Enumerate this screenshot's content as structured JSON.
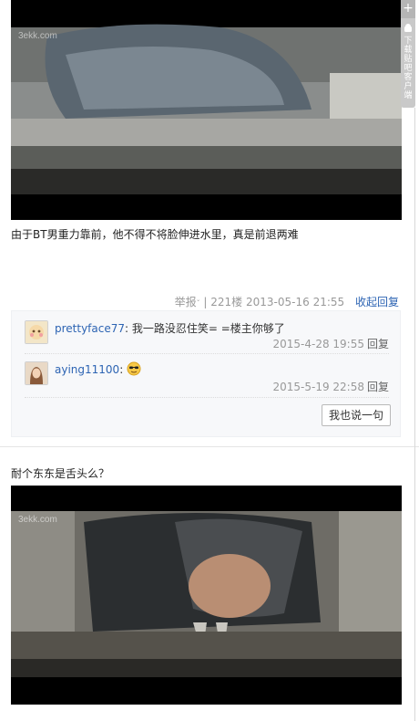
{
  "post1": {
    "watermark": "3ekk.com",
    "caption": "由于BT男重力靠前，他不得不将脸伸进水里，真是前退两难",
    "meta": {
      "report": "举报",
      "floor": "221楼",
      "date": "2013-05-16 21:55",
      "collapse": "收起回复"
    },
    "replies": [
      {
        "user": "prettyface77",
        "text": "我一路没忍住笑= =楼主你够了",
        "time": "2015-4-28 19:55",
        "reply": "回复"
      },
      {
        "user": "aying11100",
        "text": "",
        "time": "2015-5-19 22:58",
        "reply": "回复"
      }
    ],
    "say_button": "我也说一句"
  },
  "post2": {
    "caption": "耐个东东是舌头么？",
    "watermark": "3ekk.com"
  },
  "side": {
    "plus": "+",
    "text": "下载贴吧客户端"
  },
  "colors": {
    "link": "#2d64b3",
    "meta": "#999999",
    "reply_bg": "#f7f8fa"
  }
}
